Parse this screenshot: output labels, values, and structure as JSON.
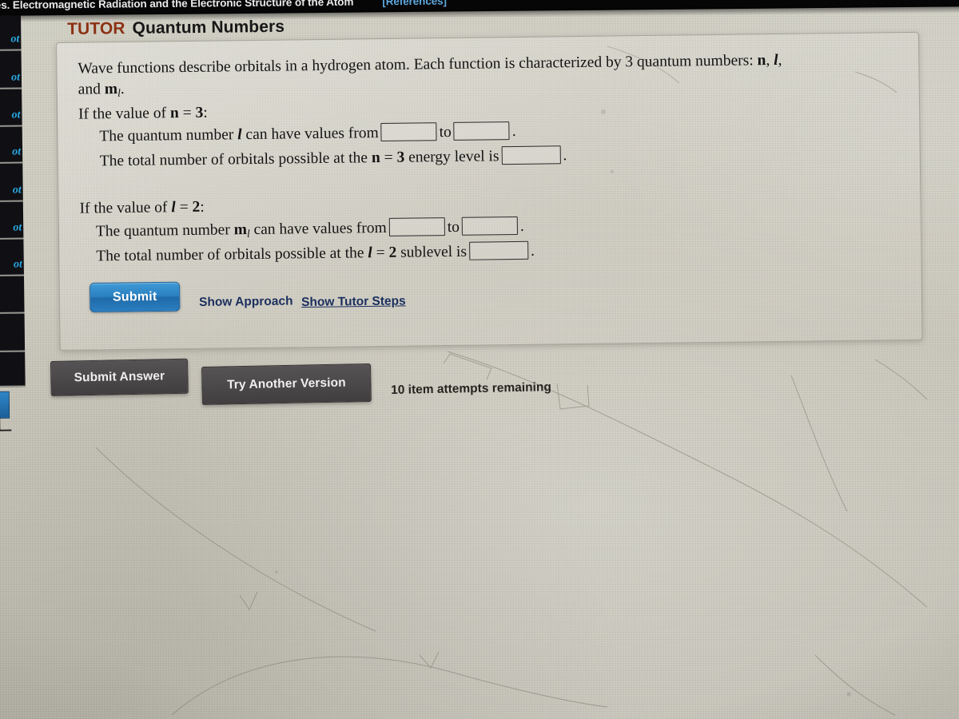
{
  "topbar": {
    "title": "ies. Electromagnetic Radiation and the Electronic Structure of the Atom",
    "references_label": "[References]"
  },
  "sidebar": {
    "items": [
      {
        "label": "ot"
      },
      {
        "label": "ot"
      },
      {
        "label": "ot"
      },
      {
        "label": "ot"
      },
      {
        "label": "ot"
      },
      {
        "label": "ot"
      },
      {
        "label": "ot"
      },
      {
        "label": ""
      },
      {
        "label": ""
      },
      {
        "label": ""
      }
    ]
  },
  "heading": {
    "tutor": "TUTOR",
    "title": "Quantum Numbers"
  },
  "content": {
    "intro_1": "Wave functions describe orbitals in a hydrogen atom. Each function is characterized by 3 quantum numbers: ",
    "intro_n": "n",
    "intro_comma1": ", ",
    "intro_l": "l",
    "intro_comma2": ",",
    "intro_2_and": "and ",
    "intro_2_ml": "m",
    "intro_2_ml_sub": "l",
    "intro_2_period": ".",
    "cond_n_prefix": "If the value of ",
    "cond_n_var": "n",
    "cond_n_eq": " = ",
    "cond_n_value": "3",
    "cond_n_colon": ":",
    "line_n_1_a": "The quantum number ",
    "line_n_1_var": "l",
    "line_n_1_b": " can have values from",
    "line_n_1_to": "to",
    "line_n_1_period": ".",
    "line_n_2_a": "The total number of orbitals possible at the ",
    "line_n_2_var": "n",
    "line_n_2_eq": " = ",
    "line_n_2_value": "3",
    "line_n_2_b": " energy level is",
    "line_n_2_period": ".",
    "cond_l_prefix": "If the value of ",
    "cond_l_var": "l",
    "cond_l_eq": " = ",
    "cond_l_value": "2",
    "cond_l_colon": ":",
    "line_l_1_a": "The quantum number ",
    "line_l_1_var": "m",
    "line_l_1_var_sub": "l",
    "line_l_1_b": " can have values from",
    "line_l_1_to": "to",
    "line_l_1_period": ".",
    "line_l_2_a": "The total number of orbitals possible at the ",
    "line_l_2_var": "l",
    "line_l_2_eq": " = ",
    "line_l_2_value": "2",
    "line_l_2_b": " sublevel is",
    "line_l_2_period": "."
  },
  "inputs": {
    "l_from": "",
    "l_to": "",
    "n_total_orbitals": "",
    "ml_from": "",
    "ml_to": "",
    "l_total_orbitals": ""
  },
  "actions": {
    "submit": "Submit",
    "show_approach": "Show Approach",
    "show_tutor_steps": "Show Tutor Steps",
    "submit_answer": "Submit Answer",
    "try_another_version": "Try Another Version",
    "attempts_remaining": "10 item attempts remaining"
  },
  "colors": {
    "tutor_red": "#8c3214",
    "link_blue": "#1b2f5e",
    "submit_blue": "#2a7fc0",
    "grey_button": "#4b484a",
    "sidebar_tab_text": "#2aa7e0",
    "topbar_bg": "#060607",
    "screen_bg": "#cecbbf"
  }
}
